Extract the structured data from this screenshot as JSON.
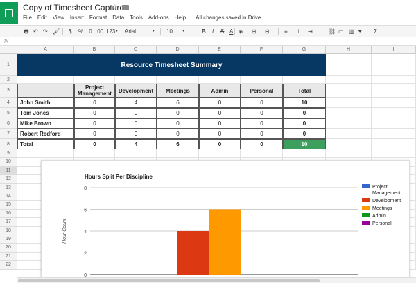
{
  "app": {
    "title": "Copy of Timesheet Capture",
    "save_status": "All changes saved in Drive"
  },
  "menu": [
    "File",
    "Edit",
    "View",
    "Insert",
    "Format",
    "Data",
    "Tools",
    "Add-ons",
    "Help"
  ],
  "toolbar": {
    "currency": "$",
    "percent": "%",
    "decimals_less": ".0",
    "decimals_more": ".00",
    "format_more": "123",
    "font": "Arial",
    "font_size": "10",
    "bold": "B",
    "italic": "I",
    "strike": "S",
    "text_color": "A",
    "sum": "Σ"
  },
  "formula_bar": {
    "fx": "fx"
  },
  "columns": [
    "A",
    "B",
    "C",
    "D",
    "E",
    "F",
    "G",
    "H",
    "I"
  ],
  "rows": [
    "1",
    "2",
    "3",
    "4",
    "5",
    "6",
    "7",
    "8",
    "9",
    "10",
    "11",
    "12",
    "13",
    "14",
    "15",
    "16",
    "17",
    "18",
    "19",
    "20",
    "21",
    "22"
  ],
  "sheet": {
    "banner": "Resource Timesheet Summary",
    "headers": [
      "Project Management",
      "Development",
      "Meetings",
      "Admin",
      "Personal",
      "Total"
    ],
    "table": [
      {
        "name": "John Smith",
        "values": [
          "0",
          "4",
          "6",
          "0",
          "0",
          "10"
        ]
      },
      {
        "name": "Tom Jones",
        "values": [
          "0",
          "0",
          "0",
          "0",
          "0",
          "0"
        ]
      },
      {
        "name": "Mike Brown",
        "values": [
          "0",
          "0",
          "0",
          "0",
          "0",
          "0"
        ]
      },
      {
        "name": "Robert Redford",
        "values": [
          "0",
          "0",
          "0",
          "0",
          "0",
          "0"
        ]
      }
    ],
    "total": {
      "name": "Total",
      "values": [
        "0",
        "4",
        "6",
        "0",
        "0",
        "10"
      ]
    },
    "total_highlight_color": "#3c9f5e"
  },
  "chart_data": {
    "type": "bar",
    "title": "Hours Split Per Discipline",
    "ylabel": "Hour Count",
    "xlabel": "",
    "ylim": [
      0,
      8
    ],
    "yticks": [
      0,
      2,
      4,
      6,
      8
    ],
    "legend_position": "right",
    "series": [
      {
        "name": "Project Management",
        "value": 0,
        "color": "#3366cc"
      },
      {
        "name": "Development",
        "value": 4,
        "color": "#dc3912"
      },
      {
        "name": "Meetings",
        "value": 6,
        "color": "#ff9900"
      },
      {
        "name": "Admin",
        "value": 0,
        "color": "#109618"
      },
      {
        "name": "Personal",
        "value": 0,
        "color": "#990099"
      }
    ]
  }
}
